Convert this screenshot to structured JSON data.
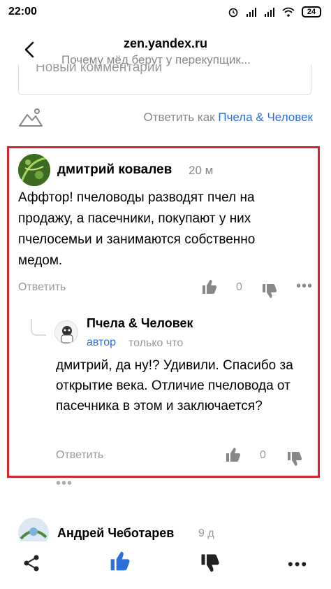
{
  "status_bar": {
    "time": "22:00",
    "battery": "24"
  },
  "header": {
    "url": "zen.yandex.ru",
    "title": "Почему мёд берут у перекупщик...",
    "more": "•••"
  },
  "new_comment": {
    "placeholder": "Новый комментарий"
  },
  "reply_as": {
    "prefix": "Ответить как ",
    "name": "Пчела & Человек"
  },
  "comments": [
    {
      "author": "дмитрий ковалев",
      "time": "20 м",
      "text": "Аффтор! пчеловоды разводят пчел на продажу, а пасечники, покупают у них пчелосемьи и занимаются собственно медом.",
      "reply_label": "Ответить",
      "likes": "0",
      "more": "•••",
      "replies": [
        {
          "author": "Пчела & Человек",
          "role": "автор",
          "time": "только что",
          "text": "дмитрий, да ну!? Удивили. Спасибо за открытие века. Отличие пчеловода от пасечника в этом и заключается?",
          "reply_label": "Ответить",
          "likes": "0"
        }
      ],
      "more_replies": "•••"
    },
    {
      "author": "Андрей Чеботарев",
      "time": "9 д"
    }
  ],
  "toolbar": {
    "more": "•••"
  },
  "colors": {
    "accent": "#2d6fd8",
    "highlight_frame": "#d8232f"
  }
}
